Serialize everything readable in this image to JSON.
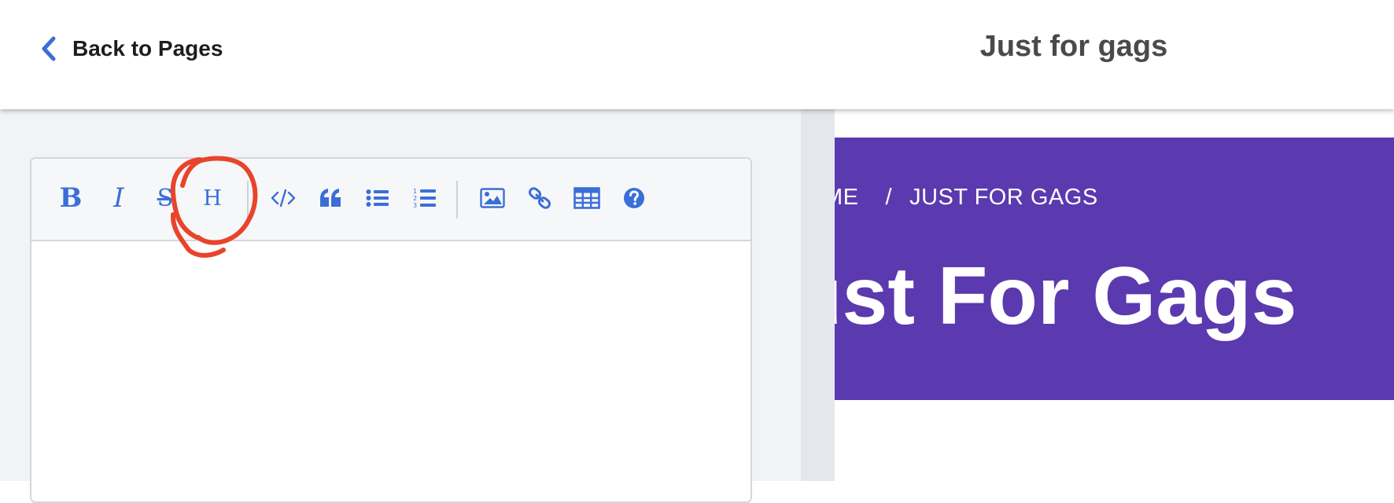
{
  "header": {
    "back_label": "Back to Pages",
    "title": "Just for gags",
    "back_icon": "chevron-left-icon"
  },
  "toolbar": {
    "bold": "B",
    "italic": "I",
    "strikethrough": "S",
    "heading": "H",
    "buttons": [
      {
        "name": "bold",
        "icon": "bold-icon"
      },
      {
        "name": "italic",
        "icon": "italic-icon"
      },
      {
        "name": "strikethrough",
        "icon": "strikethrough-icon"
      },
      {
        "name": "heading",
        "icon": "heading-icon"
      },
      {
        "name": "code",
        "icon": "code-icon"
      },
      {
        "name": "quote",
        "icon": "quote-icon"
      },
      {
        "name": "unordered-list",
        "icon": "bulleted-list-icon"
      },
      {
        "name": "ordered-list",
        "icon": "numbered-list-icon"
      },
      {
        "name": "image",
        "icon": "image-icon"
      },
      {
        "name": "link",
        "icon": "link-icon"
      },
      {
        "name": "table",
        "icon": "table-icon"
      },
      {
        "name": "help",
        "icon": "help-icon"
      }
    ]
  },
  "editor": {
    "content": ""
  },
  "annotation": {
    "color": "#e8442b",
    "shape": "hand-drawn circle around heading button"
  },
  "preview": {
    "breadcrumb_home": "ME",
    "breadcrumb_separator": "/",
    "breadcrumb_current": "JUST FOR GAGS",
    "heading": "ust For Gags",
    "hero_color": "#5a3aae"
  },
  "colors": {
    "accent": "#3b6fd8",
    "pane_background": "#f1f3f6"
  }
}
